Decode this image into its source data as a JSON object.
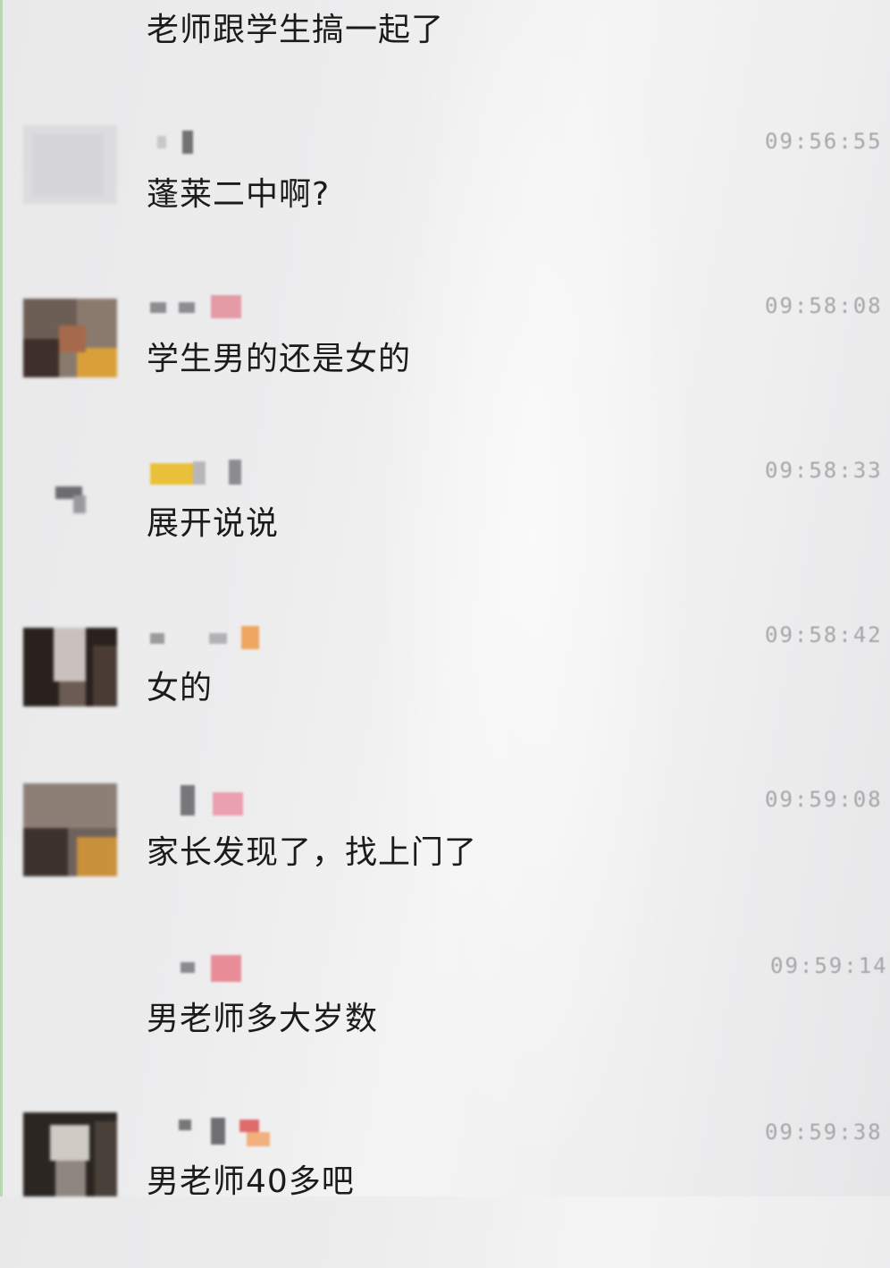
{
  "chat": {
    "top_message": {
      "text": "老师跟学生搞一起了"
    },
    "messages": [
      {
        "text": "蓬莱二中啊?",
        "time": "09:56:55"
      },
      {
        "text": "学生男的还是女的",
        "time": "09:58:08"
      },
      {
        "text": "展开说说",
        "time": "09:58:33"
      },
      {
        "text": "女的",
        "time": "09:58:42"
      },
      {
        "text": "家长发现了，找上门了",
        "time": "09:59:08"
      },
      {
        "text": "男老师多大岁数",
        "time": "09:59:14"
      },
      {
        "text": "男老师40多吧",
        "time": "09:59:38"
      }
    ]
  }
}
